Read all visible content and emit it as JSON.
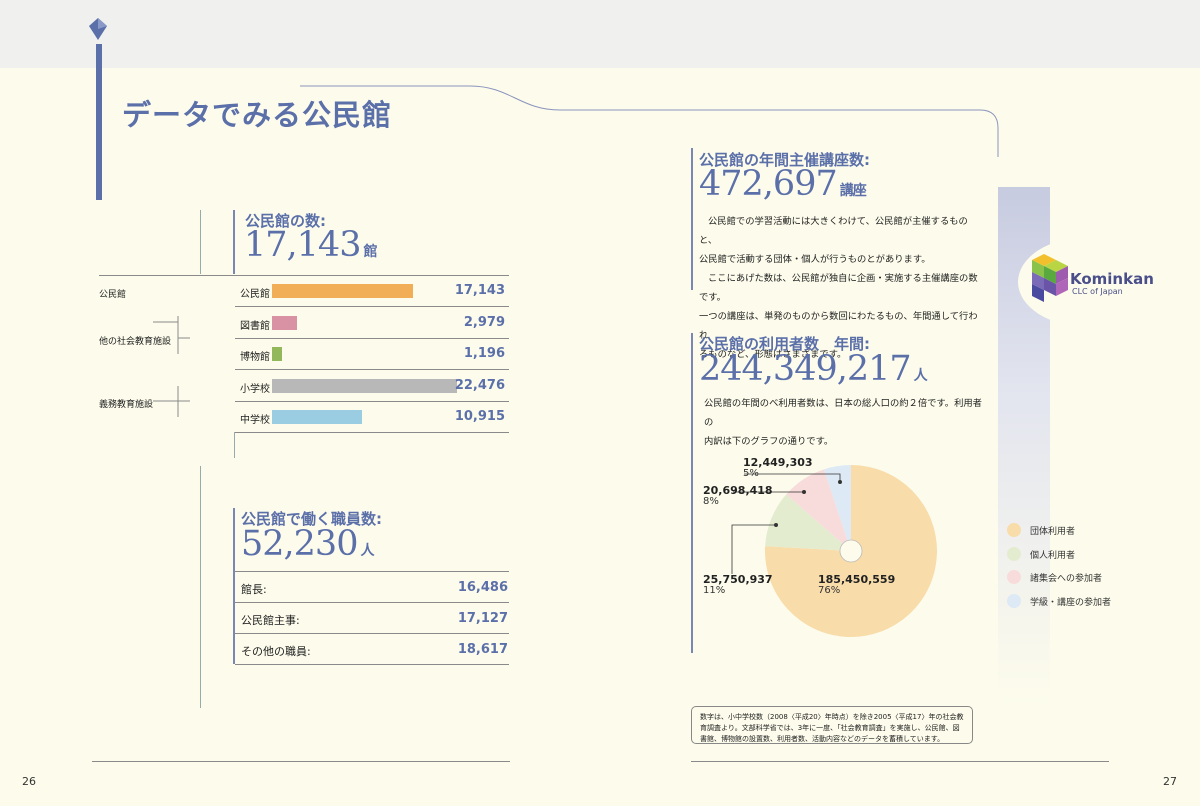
{
  "title": "データでみる公民館",
  "page_left": "26",
  "page_right": "27",
  "centers": {
    "heading": "公民館の数:",
    "number": "17,143",
    "unit": "館",
    "rows": [
      {
        "group": "公民館",
        "label": "公民館",
        "value_text": "17,143",
        "value": 17143,
        "color": "#f2ad57"
      },
      {
        "group": "他の社会教育施設",
        "label": "図書館",
        "value_text": "2,979",
        "value": 2979,
        "color": "#d892a4"
      },
      {
        "group": "",
        "label": "博物館",
        "value_text": "1,196",
        "value": 1196,
        "color": "#93b85c"
      },
      {
        "group": "義務教育施設",
        "label": "小学校",
        "value_text": "22,476",
        "value": 22476,
        "color": "#b8b8b8"
      },
      {
        "group": "",
        "label": "中学校",
        "value_text": "10,915",
        "value": 10915,
        "color": "#9bcde2"
      }
    ]
  },
  "staff": {
    "heading": "公民館で働く職員数:",
    "number": "52,230",
    "unit": "人",
    "rows": [
      {
        "label": "館長:",
        "value": "16,486"
      },
      {
        "label": "公民館主事:",
        "value": "17,127"
      },
      {
        "label": "その他の職員:",
        "value": "18,617"
      }
    ]
  },
  "courses": {
    "heading": "公民館の年間主催講座数:",
    "number": "472,697",
    "unit": "講座",
    "paragraph": [
      "公民館での学習活動には大きくわけて、公民館が主催するものと、",
      "公民館で活動する団体・個人が行うものとがあります。",
      "ここにあげた数は、公民館が独自に企画・実施する主催講座の数です。",
      "一つの講座は、単発のものから数回にわたるもの、年間通して行われ",
      "るものなど、形態はさまざまです。"
    ]
  },
  "users": {
    "heading": "公民館の利用者数　年間:",
    "number": "244,349,217",
    "unit": "人",
    "paragraph": [
      "公民館の年間のべ利用者数は、日本の総人口の約２倍です。利用者の",
      "内訳は下のグラフの通りです。"
    ]
  },
  "chart_data": {
    "type": "pie",
    "slices": [
      {
        "name": "団体利用者",
        "value": 185450559,
        "value_text": "185,450,559",
        "percent": "76%",
        "color": "#f8dcaa"
      },
      {
        "name": "個人利用者",
        "value": 25750937,
        "value_text": "25,750,937",
        "percent": "11%",
        "color": "#e4ecd0"
      },
      {
        "name": "諸集会への参加者",
        "value": 20698418,
        "value_text": "20,698,418",
        "percent": "8%",
        "color": "#f8dcdc"
      },
      {
        "name": "学級・講座の参加者",
        "value": 12449303,
        "value_text": "12,449,303",
        "percent": "5%",
        "color": "#dde9f5"
      }
    ]
  },
  "note": "数字は、小中学校数（2008〈平成20〉年時点）を除き2005〈平成17〉年の社会教育調査より。文部科学省では、3年に一度、「社会教育調査」を実施し、公民館、図書館、博物館の設置数、利用者数、活動内容などのデータを蓄積しています。",
  "logo": {
    "name": "Kominkan",
    "sub": "CLC of Japan"
  }
}
